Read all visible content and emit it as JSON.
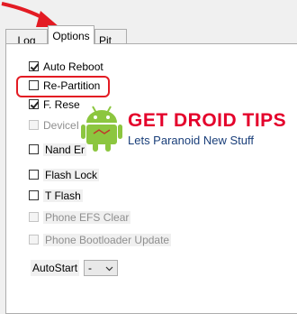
{
  "tabs": [
    {
      "label": "Log",
      "active": false
    },
    {
      "label": "Options",
      "active": true
    },
    {
      "label": "Pit",
      "active": false
    }
  ],
  "options": [
    {
      "label": "Auto Reboot",
      "checked": true,
      "enabled": true
    },
    {
      "label": "Re-Partition",
      "checked": false,
      "enabled": true
    },
    {
      "label": "F. Rese",
      "checked": true,
      "enabled": true
    },
    {
      "label": "DeviceI",
      "checked": false,
      "enabled": false
    },
    {
      "label": "Nand Er",
      "checked": false,
      "enabled": true
    },
    {
      "label": "Flash Lock",
      "checked": false,
      "enabled": true
    },
    {
      "label": "T Flash",
      "checked": false,
      "enabled": true
    },
    {
      "label": "Phone EFS Clear",
      "checked": false,
      "enabled": false
    },
    {
      "label": "Phone Bootloader Update",
      "checked": false,
      "enabled": false
    }
  ],
  "autostart": {
    "label": "AutoStart",
    "value": "-"
  },
  "watermark": {
    "title": "GET DROID TIPS",
    "subtitle": "Lets Paranoid New Stuff"
  },
  "colors": {
    "highlight": "#e31b23",
    "brand_red": "#e4002b",
    "brand_blue": "#1a3f7a",
    "android_green": "#8cc63f"
  }
}
